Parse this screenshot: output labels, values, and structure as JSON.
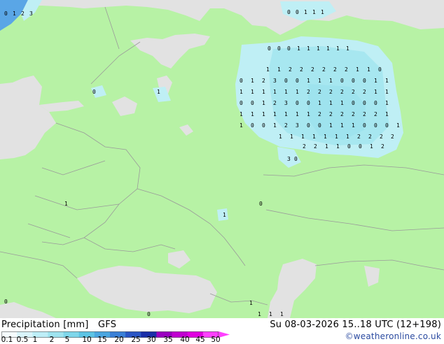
{
  "map": {
    "colors": {
      "land": "#b7f2a5",
      "sea": "#e2e2e2",
      "border": "#9a9a9a",
      "precip_light": "#bfeff5",
      "precip_mid": "#9ee3ee",
      "precip_blue": "#5aa6e6"
    },
    "precip_labels": [
      "0",
      "1",
      "2",
      "3",
      "0",
      "0",
      "1",
      "1",
      "1",
      "0",
      "0",
      "0",
      "1",
      "1",
      "1",
      "1",
      "1",
      "1",
      "1",
      "1",
      "2",
      "2",
      "2",
      "2",
      "2",
      "2",
      "1",
      "1",
      "0"
    ]
  },
  "footer": {
    "title": "Precipitation [mm]",
    "model": "GFS",
    "datetime": "Su 08-03-2026 15..18 UTC (12+198)",
    "credit": "©weatheronline.co.uk"
  },
  "legend": {
    "labels": [
      "0.1",
      "0.5",
      "1",
      "2",
      "5",
      "10",
      "15",
      "20",
      "25",
      "30",
      "35",
      "40",
      "45",
      "50"
    ],
    "colors": [
      "#f5fbfd",
      "#d9f4fa",
      "#bdeef7",
      "#9ee3ef",
      "#7ed6ea",
      "#5cc3e4",
      "#4aa6e0",
      "#3a7fd6",
      "#2a55c4",
      "#1a2ea8",
      "#9a00c0",
      "#c000d0",
      "#e000e0",
      "#ff40ff"
    ]
  }
}
